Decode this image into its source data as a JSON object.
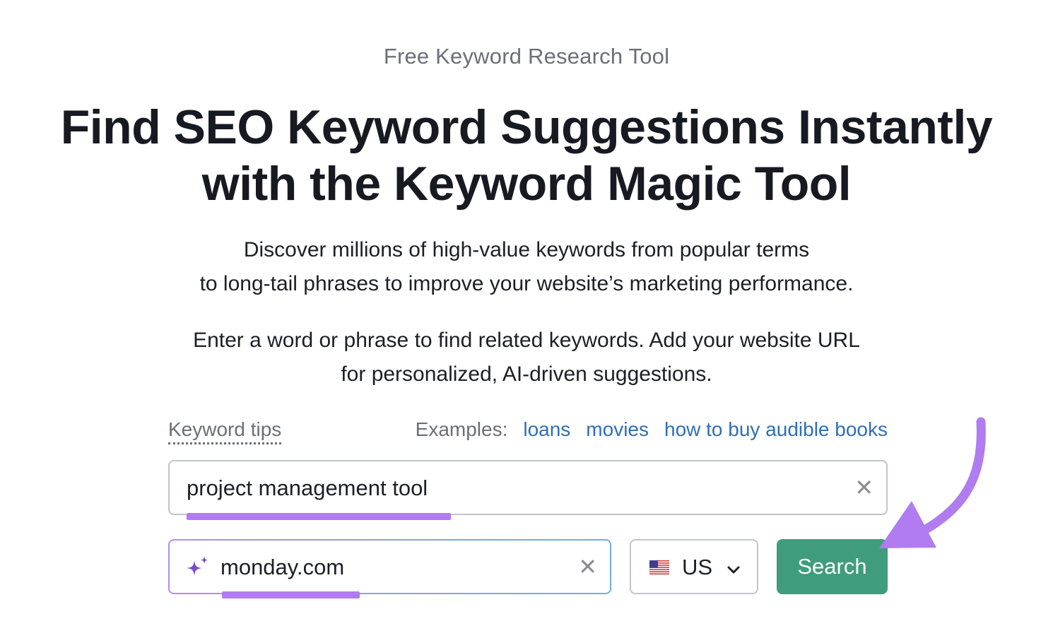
{
  "header": {
    "eyebrow": "Free Keyword Research Tool",
    "title_line1": "Find SEO Keyword Suggestions Instantly",
    "title_line2": "with the Keyword Magic Tool"
  },
  "description": {
    "line1": "Discover millions of high-value keywords from popular terms",
    "line2": "to long-tail phrases to improve your website’s marketing performance.",
    "line3": "Enter a word or phrase to find related keywords. Add your website URL",
    "line4": "for personalized, AI-driven suggestions."
  },
  "form": {
    "keyword_tips_label": "Keyword tips",
    "examples_label": "Examples:",
    "examples": [
      "loans",
      "movies",
      "how to buy audible books"
    ],
    "keyword_value": "project management tool",
    "clear_glyph": "✕",
    "url_value": "monday.com",
    "database": "US",
    "search_label": "Search"
  },
  "icons": {
    "sparkle": "sparkle-icon",
    "flag": "us-flag-icon",
    "chevron": "chevron-down-icon",
    "clear": "close-icon"
  },
  "colors": {
    "search_button": "#3f9c7d",
    "link": "#2e6fb6",
    "highlight": "#b07cf0",
    "heading": "#181a22"
  }
}
